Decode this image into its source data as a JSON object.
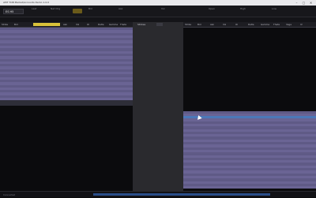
{
  "window": {
    "title": "AMT TOB Market/Accounts Demo 1.0.0",
    "minimize": "–",
    "maximize": "▢",
    "close": "✕"
  },
  "summary": {
    "symbol": "ES H5",
    "stats": [
      {
        "label": "Last",
        "value": ""
      },
      {
        "label": "Net Chg",
        "value": ""
      },
      {
        "label": "Bid",
        "value": ""
      },
      {
        "label": "Ask",
        "value": ""
      },
      {
        "label": "Vol",
        "value": ""
      },
      {
        "label": "Open",
        "value": ""
      },
      {
        "label": "High",
        "value": ""
      },
      {
        "label": "Low",
        "value": ""
      }
    ],
    "accent_color": "#d9c23a"
  },
  "subheader": {
    "left": "",
    "right": ""
  },
  "left_panel": {
    "header_cols": [
      "Strike",
      "Bid",
      "Ask",
      "Vol",
      "OI",
      "Delta",
      "Gamma",
      "Theta",
      "Vega",
      "IV"
    ]
  },
  "mid_panel": {
    "label": "Strikes"
  },
  "right_panel": {
    "header_cols": [
      "Strike",
      "Bid",
      "Ask",
      "Vol",
      "OI",
      "Delta",
      "Gamma",
      "Theta",
      "Vega",
      "IV"
    ]
  },
  "statusbar": {
    "left": "Connected",
    "right": ""
  }
}
